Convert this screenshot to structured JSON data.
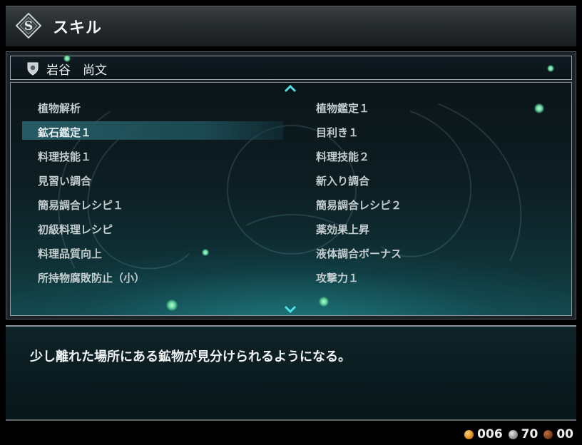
{
  "header": {
    "title": "スキル",
    "icon": "skill-emblem-icon"
  },
  "character": {
    "name": "岩谷　尚文",
    "icon": "shield-icon"
  },
  "skills": {
    "left": [
      "植物解析",
      "鉱石鑑定１",
      "料理技能１",
      "見習い調合",
      "簡易調合レシピ１",
      "初級料理レシピ",
      "料理品質向上",
      "所持物腐敗防止（小）"
    ],
    "right": [
      "植物鑑定１",
      "目利き１",
      "料理技能２",
      "新入り調合",
      "簡易調合レシピ２",
      "薬効果上昇",
      "液体調合ボーナス",
      "攻撃力１"
    ],
    "selected": "鉱石鑑定１"
  },
  "description": "少し離れた場所にある鉱物が見分けられるようになる。",
  "currency": [
    {
      "name": "gold",
      "value": "006",
      "color": "#e08a1e"
    },
    {
      "name": "silver",
      "value": "70",
      "color": "#8f9396"
    },
    {
      "name": "bronze",
      "value": "00",
      "color": "#7a3a1a"
    }
  ],
  "colors": {
    "accent": "#2aa6a8",
    "selection": "#28606a",
    "particle": "#5fd49a"
  }
}
